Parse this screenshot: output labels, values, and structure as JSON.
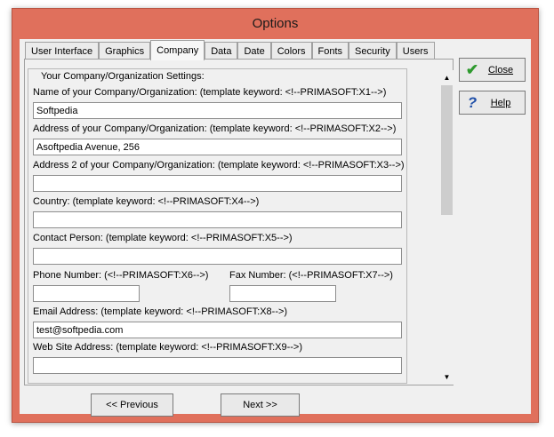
{
  "window": {
    "title": "Options"
  },
  "tabs": [
    "User Interface",
    "Graphics",
    "Company",
    "Data",
    "Date",
    "Colors",
    "Fonts",
    "Security",
    "Users"
  ],
  "group_title": "Your Company/Organization Settings:",
  "fields": {
    "name": {
      "label": "Name of your Company/Organization:   (template keyword: <!--PRIMASOFT:X1-->)",
      "value": "Softpedia"
    },
    "address": {
      "label": "Address of your Company/Organization:   (template keyword: <!--PRIMASOFT:X2-->)",
      "value": "Asoftpedia Avenue, 256"
    },
    "address2": {
      "label": "Address 2 of your Company/Organization:   (template keyword: <!--PRIMASOFT:X3-->)",
      "value": ""
    },
    "country": {
      "label": "Country:   (template keyword: <!--PRIMASOFT:X4-->)",
      "value": ""
    },
    "contact": {
      "label": "Contact Person:   (template keyword: <!--PRIMASOFT:X5-->)",
      "value": ""
    },
    "phone": {
      "label": "Phone Number:   (<!--PRIMASOFT:X6-->)",
      "value": ""
    },
    "fax": {
      "label": "Fax Number:   (<!--PRIMASOFT:X7-->)",
      "value": ""
    },
    "email": {
      "label": "Email Address:   (template keyword: <!--PRIMASOFT:X8-->)",
      "value": "test@softpedia.com"
    },
    "website": {
      "label": "Web Site Address:   (template keyword: <!--PRIMASOFT:X9-->)",
      "value": ""
    }
  },
  "buttons": {
    "close": "Close",
    "help": "Help",
    "previous": "<< Previous",
    "next": "Next >>"
  },
  "icons": {
    "close": "checkmark-icon",
    "help": "question-mark-icon",
    "scroll_up": "arrow-up-icon",
    "scroll_down": "arrow-down-icon"
  },
  "colors": {
    "title_bar": "#e0705c",
    "client_bg": "#f0f0f0",
    "check_green": "#2e9a2e",
    "help_blue": "#1f4fa8"
  }
}
